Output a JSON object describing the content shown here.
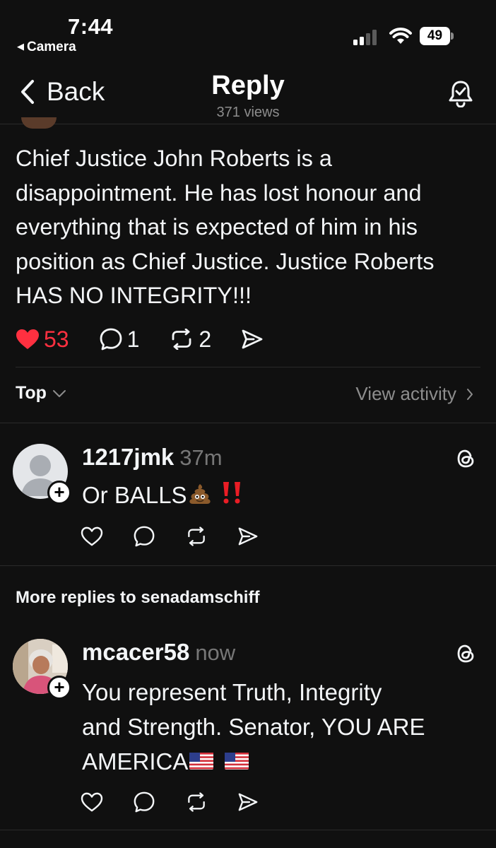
{
  "status_bar": {
    "time": "7:44",
    "back_app": "Camera",
    "battery": "49"
  },
  "nav": {
    "back_label": "Back",
    "title": "Reply",
    "views": "371 views"
  },
  "post": {
    "text": "Chief Justice John Roberts is a disappointment. He has lost honour and everything that is expected of him in his position as Chief Justice. Justice Roberts HAS NO INTEGRITY!!!",
    "likes": "53",
    "comments": "1",
    "reposts": "2",
    "liked": true
  },
  "sort": {
    "label": "Top",
    "view_activity": "View activity"
  },
  "replies": [
    {
      "username": "1217jmk",
      "time": "37m",
      "text_parts": [
        "Or BALLS"
      ],
      "emojis": [
        "pile-of-poo",
        "double-exclamation"
      ]
    }
  ],
  "more_replies_label": "More replies to senadamschiff",
  "more_replies": [
    {
      "username": "mcacer58",
      "time": "now",
      "line1": "You represent Truth,  Integrity",
      "line2": "and Strength.  Senator, YOU ARE",
      "line3": "AMERICA",
      "emojis": [
        "us-flag",
        "us-flag"
      ]
    }
  ],
  "colors": {
    "background": "#101010",
    "text": "#f3f5f7",
    "secondary": "#8d8d8d",
    "like": "#ff3040",
    "divider": "#2a2a2a"
  }
}
